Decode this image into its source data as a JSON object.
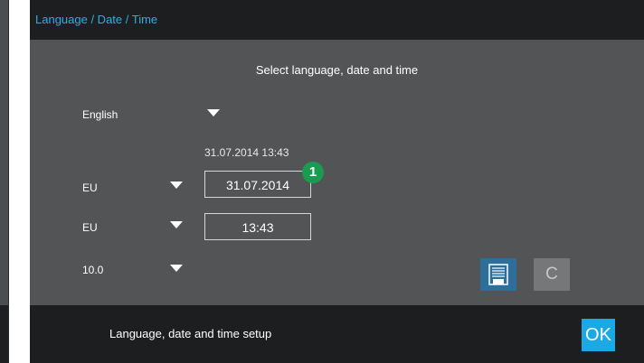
{
  "titlebar": {
    "title": "Language / Date / Time"
  },
  "main": {
    "heading": "Select language, date and time",
    "language": {
      "value": "English"
    },
    "current_datetime": "31.07.2014 13:43",
    "date_format": {
      "value": "EU"
    },
    "date_field": {
      "value": "31.07.2014"
    },
    "step_badge": "1",
    "time_format": {
      "value": "EU"
    },
    "time_field": {
      "value": "13:43"
    },
    "timezone": {
      "value": "10.0"
    }
  },
  "actions": {
    "save_icon": "save-icon",
    "cancel_label": "C"
  },
  "footer": {
    "text": "Language, date and time setup",
    "ok_label": "OK"
  },
  "colors": {
    "accent": "#26b0e8",
    "ok_button": "#1aa9e4",
    "save_button": "#2d6f9b",
    "badge": "#1a9b52",
    "panel": "#525456",
    "bar": "#1d1e1f"
  }
}
